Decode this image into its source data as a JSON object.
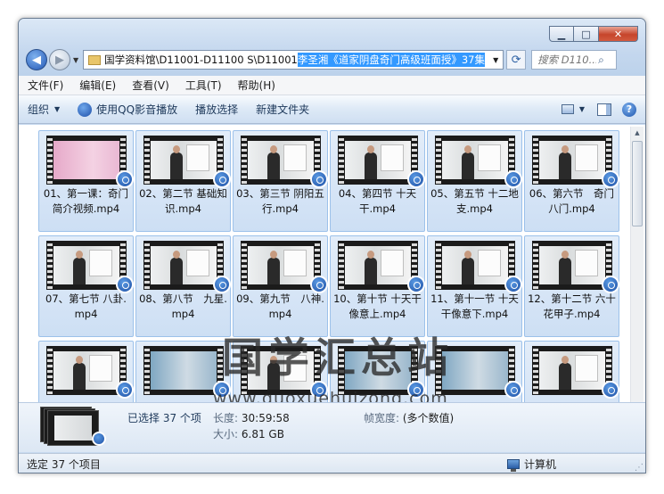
{
  "window": {
    "caption": {
      "minimize": "▁",
      "maximize": "□",
      "close": "✕"
    }
  },
  "nav": {
    "back": "◀",
    "forward": "▶",
    "address_path": "国学资料馆\\D11001-D11100 S\\D11001 ",
    "address_selected": "李圣湘《道家阴盘奇门高级班面授》37集",
    "search_placeholder": "搜索 D110..."
  },
  "menu": [
    "文件(F)",
    "编辑(E)",
    "查看(V)",
    "工具(T)",
    "帮助(H)"
  ],
  "commands": {
    "organize": "组织",
    "play_qq": "使用QQ影音播放",
    "play_selection": "播放选择",
    "new_folder": "新建文件夹",
    "help": "?"
  },
  "files": [
    {
      "label": "01、第一课：奇门简介视频.mp4",
      "style": "pink"
    },
    {
      "label": "02、第二节 基础知识.mp4",
      "style": "class"
    },
    {
      "label": "03、第三节 阴阳五行.mp4",
      "style": "class"
    },
    {
      "label": "04、第四节 十天干.mp4",
      "style": "class"
    },
    {
      "label": "05、第五节 十二地支.mp4",
      "style": "class"
    },
    {
      "label": "06、第六节　奇门八门.mp4",
      "style": "class"
    },
    {
      "label": "07、第七节 八卦.mp4",
      "style": "class"
    },
    {
      "label": "08、第八节　九星.mp4",
      "style": "class"
    },
    {
      "label": "09、第九节　八神.mp4",
      "style": "class"
    },
    {
      "label": "10、第十节 十天干像意上.mp4",
      "style": "class"
    },
    {
      "label": "11、第十一节 十天干像意下.mp4",
      "style": "class"
    },
    {
      "label": "12、第十二节 六十花甲子.mp4",
      "style": "class"
    },
    {
      "label": "",
      "style": "class"
    },
    {
      "label": "",
      "style": "blue"
    },
    {
      "label": "",
      "style": "class"
    },
    {
      "label": "",
      "style": "blue"
    },
    {
      "label": "",
      "style": "blue"
    },
    {
      "label": "",
      "style": "class"
    }
  ],
  "watermark": {
    "title": "国学汇总站",
    "url": "www.guoxuehuizong.com"
  },
  "details": {
    "selected": "已选择 37 个项",
    "length_label": "长度:",
    "length_value": "30:59:58",
    "size_label": "大小:",
    "size_value": "6.81 GB",
    "framewidth_label": "帧宽度:",
    "framewidth_value": "(多个数值)"
  },
  "status": {
    "left": "选定 37 个项目",
    "location": "计算机"
  },
  "scroll": {
    "up": "▲",
    "down": "▼"
  }
}
